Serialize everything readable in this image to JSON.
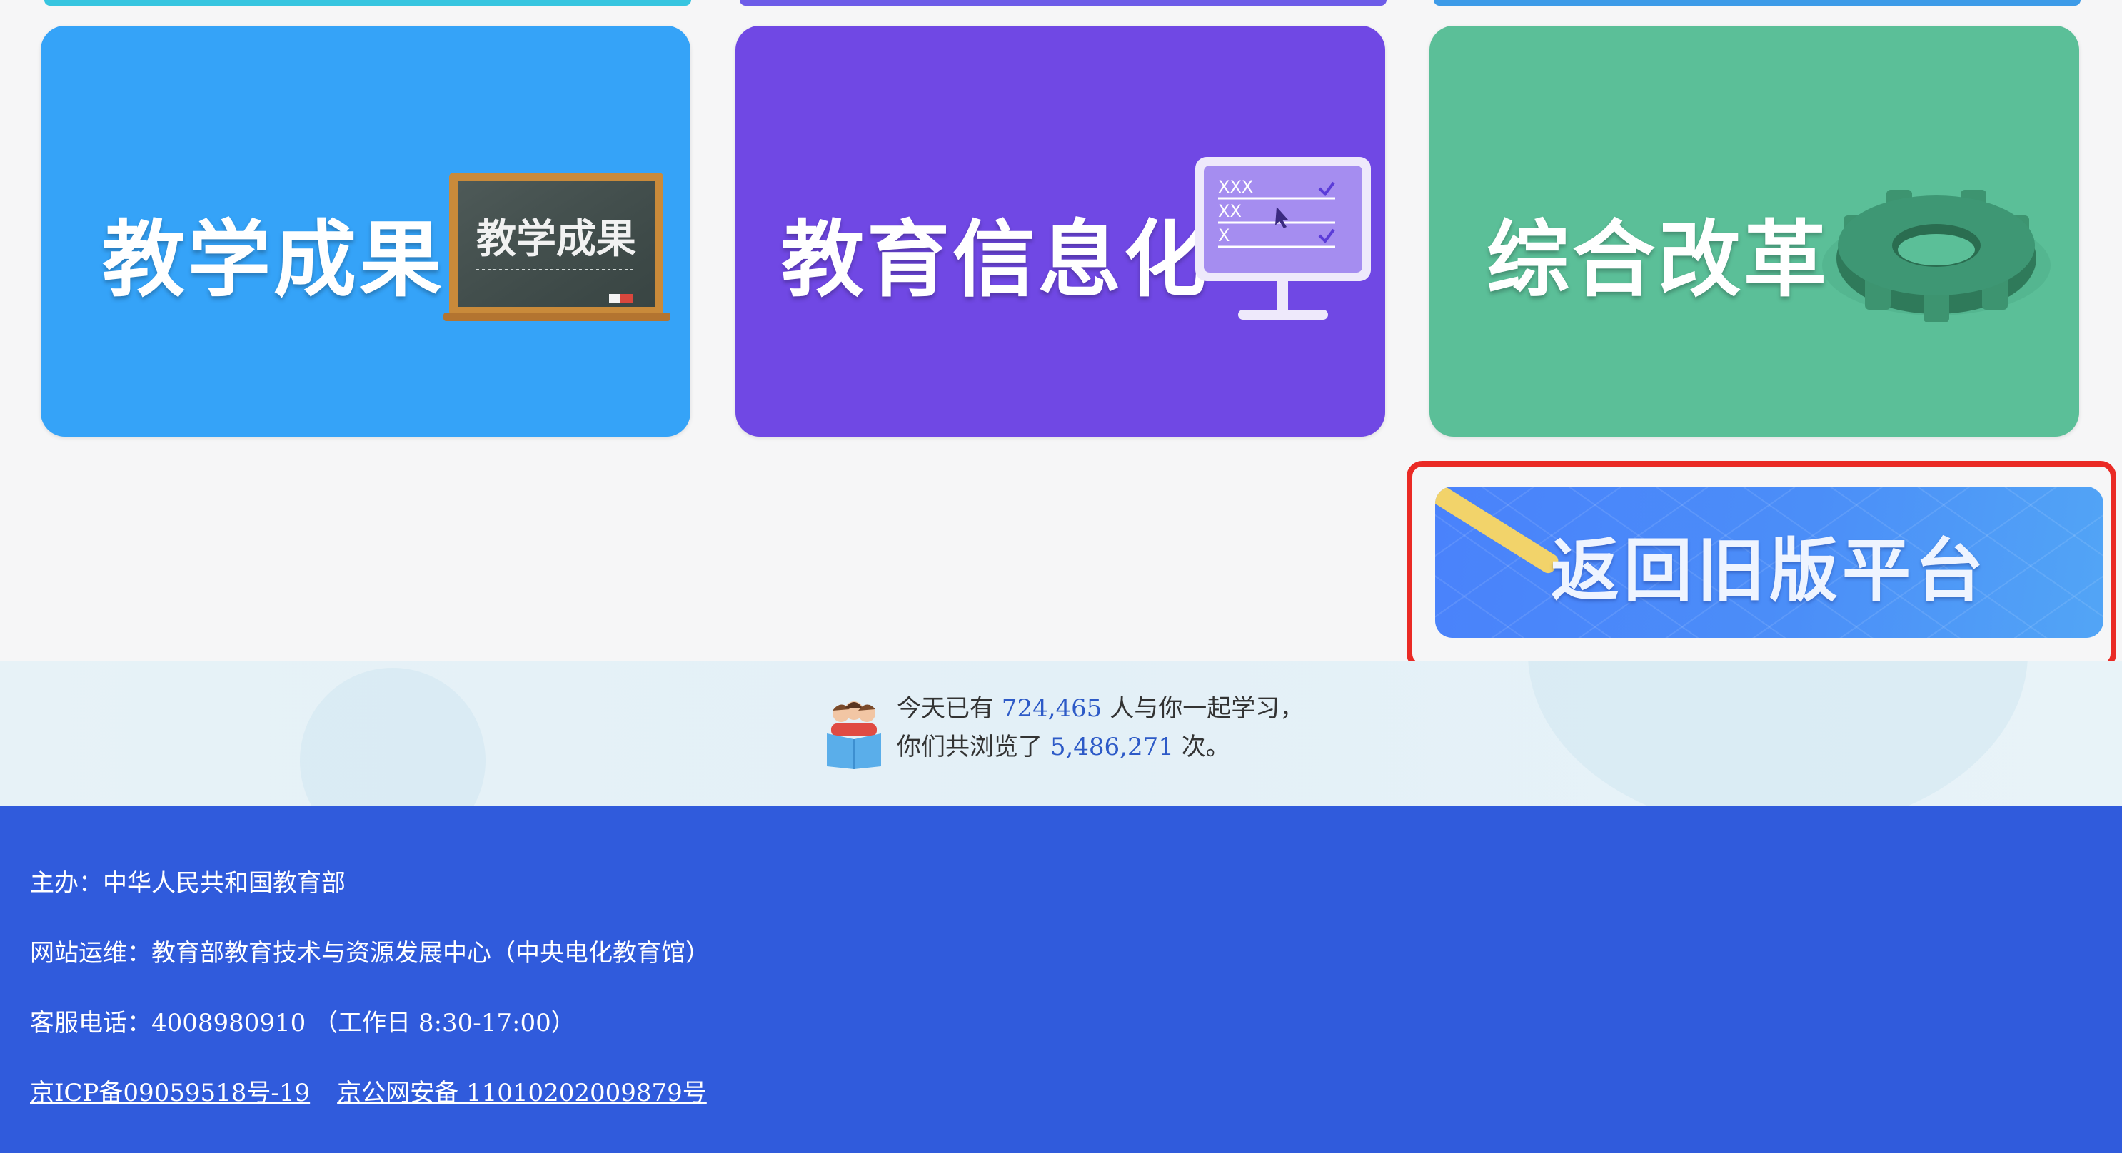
{
  "cards": [
    {
      "title": "教学成果",
      "board_text": "教学成果",
      "color": "#35a3f8",
      "icon": "chalkboard-icon"
    },
    {
      "title": "教育信息化",
      "color": "#7048e4",
      "icon": "monitor-checklist-icon"
    },
    {
      "title": "综合改革",
      "color": "#5bbf98",
      "icon": "gear-icon"
    }
  ],
  "old_platform_button": {
    "label": "返回旧版平台",
    "highlight_color": "#ea2a25"
  },
  "stats": {
    "prefix_1": "今天已有",
    "learners": "724,465",
    "suffix_1": "人与你一起学习，",
    "prefix_2": "你们共浏览了",
    "views": "5,486,271",
    "suffix_2": "次。",
    "icon": "reading-people-icon"
  },
  "footer": {
    "organizer": "主办：中华人民共和国教育部",
    "operator": "网站运维：教育部教育技术与资源发展中心（中央电化教育馆）",
    "hotline": "客服电话：4008980910 （工作日 8:30-17:00）",
    "icp": "京ICP备09059518号-19",
    "police": "京公网安备 11010202009879号",
    "bg_color": "#305bdc"
  }
}
